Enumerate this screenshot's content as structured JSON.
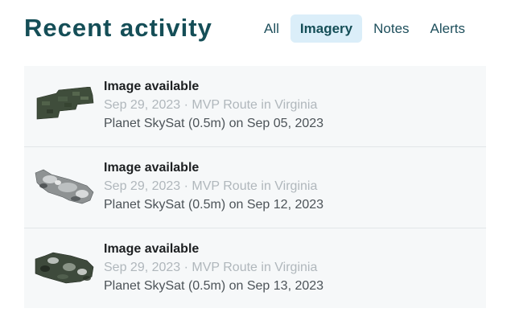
{
  "header": {
    "title": "Recent activity",
    "tabs": [
      {
        "label": "All",
        "active": false
      },
      {
        "label": "Imagery",
        "active": true
      },
      {
        "label": "Notes",
        "active": false
      },
      {
        "label": "Alerts",
        "active": false
      }
    ]
  },
  "colors": {
    "title": "#154e57",
    "active_tab_bg": "#dbeef9",
    "list_bg": "#f6f8f9",
    "meta_text": "#b0b7bc"
  },
  "activity": [
    {
      "title": "Image available",
      "meta": "Sep 29, 2023 · MVP Route in Virginia",
      "source": "Planet SkySat (0.5m) on Sep 05, 2023",
      "thumbnail": "satellite-strip-dark-green"
    },
    {
      "title": "Image available",
      "meta": "Sep 29, 2023 · MVP Route in Virginia",
      "source": "Planet SkySat (0.5m) on Sep 12, 2023",
      "thumbnail": "satellite-strip-cloudy"
    },
    {
      "title": "Image available",
      "meta": "Sep 29, 2023 · MVP Route in Virginia",
      "source": "Planet SkySat (0.5m) on Sep 13, 2023",
      "thumbnail": "satellite-strip-mixed"
    }
  ]
}
